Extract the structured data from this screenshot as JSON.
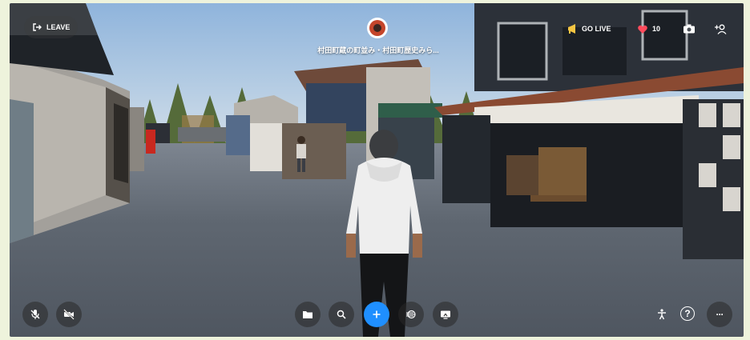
{
  "top_bar": {
    "leave_label": "LEAVE",
    "room_title": "村田町蔵の町並み・村田町歴史みら...",
    "go_live_label": "GO LIVE",
    "like_count": "10"
  },
  "icons": {
    "leave": "exit-icon",
    "avatar": "host-avatar",
    "go_live": "megaphone-icon",
    "like": "heart-icon",
    "camera": "camera-icon",
    "add_friend": "add-person-icon",
    "mic": "mic-muted-icon",
    "video": "video-off-icon",
    "folder": "folder-icon",
    "search": "search-icon",
    "plus": "plus-icon",
    "effects": "effects-icon",
    "screen": "screen-share-icon",
    "accessibility": "accessibility-icon",
    "help": "help-icon",
    "more": "more-icon"
  },
  "bottom_bar": {
    "help_label": "?",
    "more_label": "···"
  },
  "colors": {
    "accent": "#1f8fff",
    "heart": "#ff4b5c",
    "go_live": "#f5c542"
  }
}
